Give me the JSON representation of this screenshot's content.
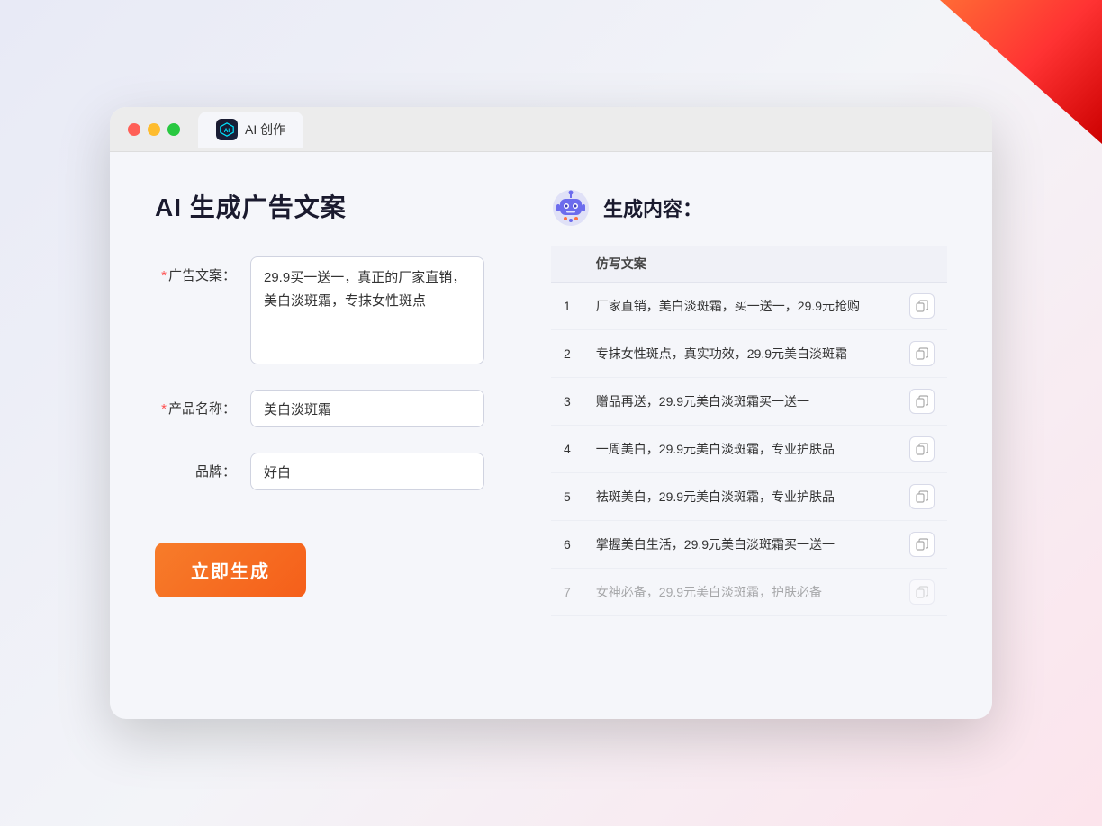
{
  "browser": {
    "tab_label": "AI 创作",
    "dots": [
      "red",
      "yellow",
      "green"
    ]
  },
  "page": {
    "title": "AI 生成广告文案",
    "right_title": "生成内容："
  },
  "form": {
    "ad_copy_label": "广告文案：",
    "ad_copy_required": "*",
    "ad_copy_value": "29.9买一送一，真正的厂家直销，美白淡斑霜，专抹女性斑点",
    "product_name_label": "产品名称：",
    "product_name_required": "*",
    "product_name_value": "美白淡斑霜",
    "brand_label": "品牌：",
    "brand_value": "好白",
    "generate_button": "立即生成"
  },
  "results": {
    "column_header": "仿写文案",
    "items": [
      {
        "num": "1",
        "text": "厂家直销，美白淡斑霜，买一送一，29.9元抢购"
      },
      {
        "num": "2",
        "text": "专抹女性斑点，真实功效，29.9元美白淡斑霜"
      },
      {
        "num": "3",
        "text": "赠品再送，29.9元美白淡斑霜买一送一"
      },
      {
        "num": "4",
        "text": "一周美白，29.9元美白淡斑霜，专业护肤品"
      },
      {
        "num": "5",
        "text": "祛斑美白，29.9元美白淡斑霜，专业护肤品"
      },
      {
        "num": "6",
        "text": "掌握美白生活，29.9元美白淡斑霜买一送一"
      },
      {
        "num": "7",
        "text": "女神必备，29.9元美白淡斑霜，护肤必备",
        "faded": true
      }
    ]
  }
}
